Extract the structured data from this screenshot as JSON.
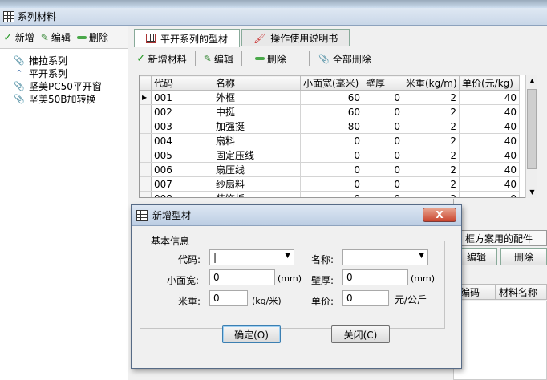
{
  "window": {
    "title": "系列材料"
  },
  "left": {
    "toolbar": {
      "add": "新增",
      "edit": "编辑",
      "delete": "删除"
    },
    "tree": [
      {
        "label": "推拉系列",
        "icon": "clip"
      },
      {
        "label": "平开系列",
        "icon": "wave"
      },
      {
        "label": "坚美PC50平开窗",
        "icon": "clip"
      },
      {
        "label": "坚美50B加转换",
        "icon": "clip"
      }
    ]
  },
  "tabs": [
    {
      "label": "平开系列的型材",
      "icon": "grid"
    },
    {
      "label": "操作使用说明书",
      "icon": "brush"
    }
  ],
  "right_toolbar": {
    "add": "新增材料",
    "edit": "编辑",
    "delete": "删除",
    "delete_all": "全部删除"
  },
  "table": {
    "headers": [
      "代码",
      "名称",
      "小面宽(毫米)",
      "壁厚",
      "米重(kg/m)",
      "单价(元/kg)"
    ],
    "rows": [
      [
        "001",
        "外框",
        "60",
        "0",
        "2",
        "40"
      ],
      [
        "002",
        "中挺",
        "60",
        "0",
        "2",
        "40"
      ],
      [
        "003",
        "加强挺",
        "80",
        "0",
        "2",
        "40"
      ],
      [
        "004",
        "扇料",
        "0",
        "0",
        "2",
        "40"
      ],
      [
        "005",
        "固定压线",
        "0",
        "0",
        "2",
        "40"
      ],
      [
        "006",
        "扇压线",
        "0",
        "0",
        "2",
        "40"
      ],
      [
        "007",
        "纱扇料",
        "0",
        "0",
        "2",
        "40"
      ],
      [
        "008",
        "装饰板",
        "0",
        "0",
        "2",
        "0"
      ]
    ]
  },
  "lower": {
    "tab_label": "框方案用的配件",
    "edit": "编辑",
    "delete": "删除",
    "grid_headers": [
      "编码",
      "材料名称"
    ]
  },
  "dialog": {
    "title": "新增型材",
    "close": "X",
    "group": "基本信息",
    "code_label": "代码:",
    "code_value": "|",
    "name_label": "名称:",
    "name_value": "",
    "width_label": "小面宽:",
    "width_value": "0",
    "width_unit": "(mm)",
    "thickness_label": "壁厚:",
    "thickness_value": "0",
    "thickness_unit": "(mm)",
    "weight_label": "米重:",
    "weight_value": "0",
    "weight_unit": "(kg/米)",
    "price_label": "单价:",
    "price_value": "0",
    "price_unit": "元/公斤",
    "ok": "确定(O)",
    "cancel": "关闭(C)"
  }
}
